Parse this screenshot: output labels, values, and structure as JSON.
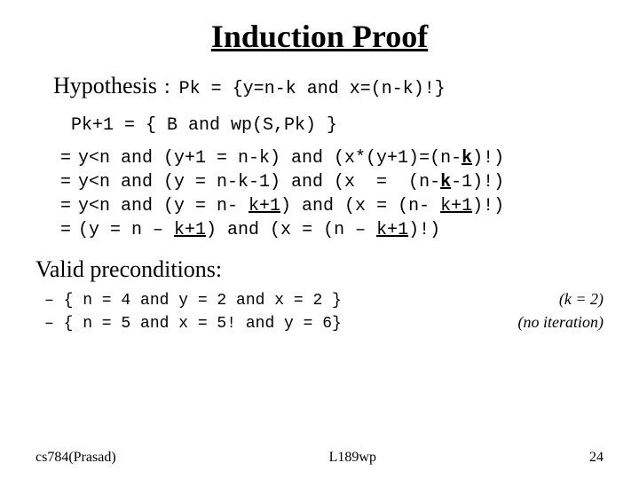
{
  "title": "Induction Proof",
  "hypothesis": {
    "label": "Hypothesis",
    "colon": ":",
    "content": "Pk = {y=n-k and x=(n-k)!}"
  },
  "pk1_line": {
    "content": "Pk+1   =   { B   and   wp(S,Pk) }"
  },
  "proof_lines": [
    {
      "eq": "=",
      "content": "y<n and (y+1 = n-k) and (x*(y+1)=(n-k)!)"
    },
    {
      "eq": "=",
      "content": "y<n and (y = n-k-1) and (x  =  (n-k-1)!)"
    },
    {
      "eq": "=",
      "content": "y<n and (y = n- k+1) and (x = (n- k+1)!)"
    },
    {
      "eq": "=",
      "content": "(y = n - k+1) and (x = (n - k+1)!)"
    }
  ],
  "valid_section": {
    "title": "Valid preconditions:",
    "lines": [
      {
        "content": "- { n = 4 and y = 2 and x = 2 }",
        "comment": "(k = 2)"
      },
      {
        "content": "- { n = 5 and x = 5! and y = 6}",
        "comment": "(no iteration)"
      }
    ]
  },
  "footer": {
    "left": "cs784(Prasad)",
    "center": "L189wp",
    "right": "24"
  }
}
